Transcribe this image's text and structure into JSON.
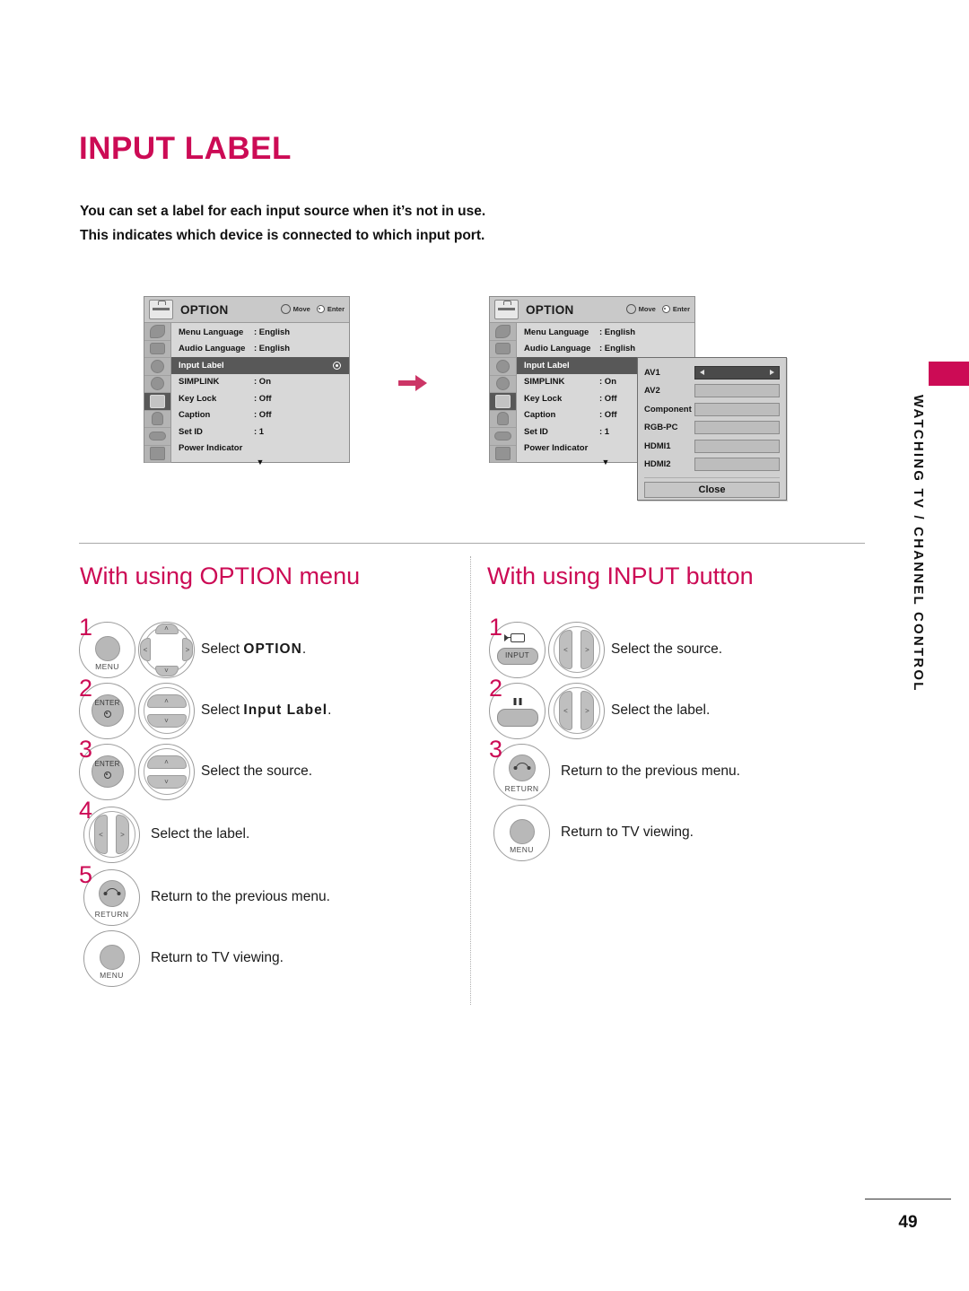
{
  "page": {
    "title": "INPUT LABEL",
    "intro_line1": "You can set a label for each input source when it’s not in use.",
    "intro_line2": "This indicates which device is connected to which input port.",
    "page_number": "49",
    "side_tab_text": "WATCHING TV / CHANNEL CONTROL",
    "accent_color": "#cc0b55"
  },
  "osd": {
    "title": "OPTION",
    "hint_move": "Move",
    "hint_enter": "Enter",
    "more_indicator": "▼",
    "rows": [
      {
        "label": "Menu Language",
        "value": ": English"
      },
      {
        "label": "Audio Language",
        "value": ": English"
      },
      {
        "label": "Input Label",
        "value": ""
      },
      {
        "label": "SIMPLINK",
        "value": ": On"
      },
      {
        "label": "Key Lock",
        "value": ": Off"
      },
      {
        "label": "Caption",
        "value": ": Off"
      },
      {
        "label": "Set ID",
        "value": ": 1"
      },
      {
        "label": "Power Indicator",
        "value": ""
      }
    ],
    "rail_icons": [
      "picture-icon",
      "screen-icon",
      "audio-icon",
      "time-icon",
      "option-icon",
      "lock-icon",
      "usb-icon",
      "input-icon"
    ]
  },
  "input_label_popup": {
    "sources": [
      "AV1",
      "AV2",
      "Component",
      "RGB-PC",
      "HDMI1",
      "HDMI2"
    ],
    "selected_index": 0,
    "left_arrow": "◀",
    "right_arrow": "▶",
    "close_label": "Close"
  },
  "sections": {
    "left": {
      "heading": "With using OPTION menu",
      "steps": [
        {
          "num": "1",
          "buttons": [
            "menu",
            "nav4"
          ],
          "text_prefix": "Select ",
          "text_bold": "OPTION",
          "text_suffix": "."
        },
        {
          "num": "2",
          "buttons": [
            "enter",
            "navud"
          ],
          "text_prefix": "Select ",
          "text_bold": "Input Label",
          "text_suffix": "."
        },
        {
          "num": "3",
          "buttons": [
            "enter",
            "navud"
          ],
          "text_prefix": "Select the source.",
          "text_bold": "",
          "text_suffix": ""
        },
        {
          "num": "4",
          "buttons": [
            "navlr"
          ],
          "text_prefix": "Select the label.",
          "text_bold": "",
          "text_suffix": ""
        },
        {
          "num": "5",
          "buttons": [
            "return"
          ],
          "text_prefix": "Return to the previous menu.",
          "text_bold": "",
          "text_suffix": ""
        },
        {
          "num": "",
          "buttons": [
            "menu"
          ],
          "text_prefix": "Return to TV viewing.",
          "text_bold": "",
          "text_suffix": ""
        }
      ]
    },
    "right": {
      "heading": "With using INPUT button",
      "steps": [
        {
          "num": "1",
          "buttons": [
            "input",
            "navlr"
          ],
          "text_prefix": "Select the source.",
          "text_bold": "",
          "text_suffix": ""
        },
        {
          "num": "2",
          "buttons": [
            "pause",
            "navlr"
          ],
          "text_prefix": "Select the label.",
          "text_bold": "",
          "text_suffix": ""
        },
        {
          "num": "3",
          "buttons": [
            "return"
          ],
          "text_prefix": "Return to the previous menu.",
          "text_bold": "",
          "text_suffix": ""
        },
        {
          "num": "",
          "buttons": [
            "menu"
          ],
          "text_prefix": "Return to TV viewing.",
          "text_bold": "",
          "text_suffix": ""
        }
      ]
    }
  },
  "button_captions": {
    "menu": "MENU",
    "enter": "ENTER",
    "return": "RETURN",
    "input": "INPUT"
  },
  "nav_glyphs": {
    "up": "˄",
    "down": "˅",
    "left": "˂",
    "right": "˃"
  }
}
